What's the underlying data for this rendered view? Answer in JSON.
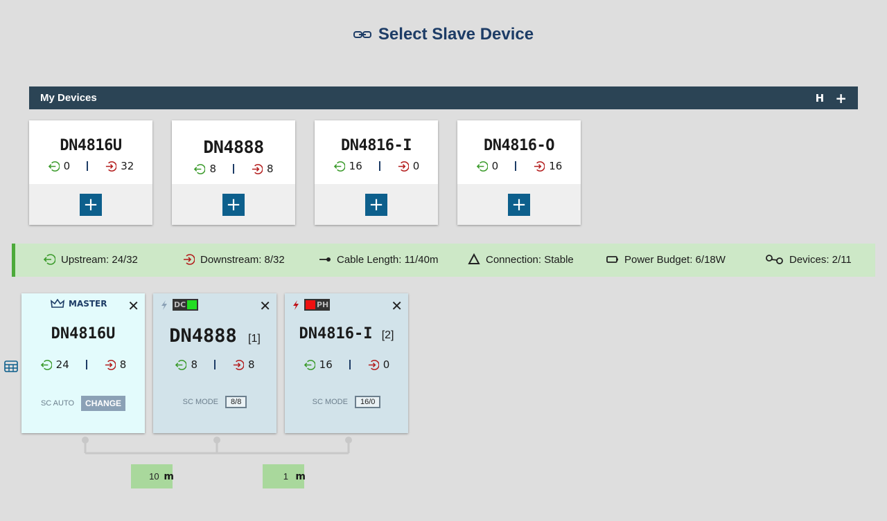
{
  "page": {
    "title": "Select Slave Device"
  },
  "my_devices": {
    "label": "My Devices",
    "h_label": "H",
    "add_label": "+",
    "cards": [
      {
        "name": "DN4816U",
        "in": "0",
        "out": "32",
        "add": "+"
      },
      {
        "name": "DN4888",
        "in": "8",
        "out": "8",
        "add": "+"
      },
      {
        "name": "DN4816-I",
        "in": "16",
        "out": "0",
        "add": "+"
      },
      {
        "name": "DN4816-O",
        "in": "0",
        "out": "16",
        "add": "+"
      }
    ]
  },
  "status": {
    "upstream": "Upstream: 24/32",
    "downstream": "Downstream: 8/32",
    "cable": "Cable Length: 11/40m",
    "connection": "Connection: Stable",
    "power": "Power Budget: 6/18W",
    "devices": "Devices: 2/11"
  },
  "chain": {
    "master": {
      "badge": "MASTER",
      "name": "DN4816U",
      "in": "24",
      "out": "8",
      "mode": "SC AUTO",
      "change": "CHANGE",
      "close": "✕"
    },
    "slaves": [
      {
        "pill": "DC",
        "pill_color": "#22dd22",
        "name": "DN4888",
        "index": "[1]",
        "in": "8",
        "out": "8",
        "mode": "SC MODE",
        "mode_value": "8/8",
        "close": "✕"
      },
      {
        "pill": "PH",
        "pill_color": "#ee1111",
        "name": "DN4816-I",
        "index": "[2]",
        "in": "16",
        "out": "0",
        "mode": "SC MODE",
        "mode_value": "16/0",
        "close": "✕"
      }
    ]
  },
  "cables": [
    {
      "value": "10",
      "unit": "m"
    },
    {
      "value": "1",
      "unit": "m"
    }
  ],
  "colors": {
    "in": "#3a9a2a",
    "out": "#b31b1b",
    "accent": "#0d5f8c",
    "navy": "#1d3c66"
  }
}
